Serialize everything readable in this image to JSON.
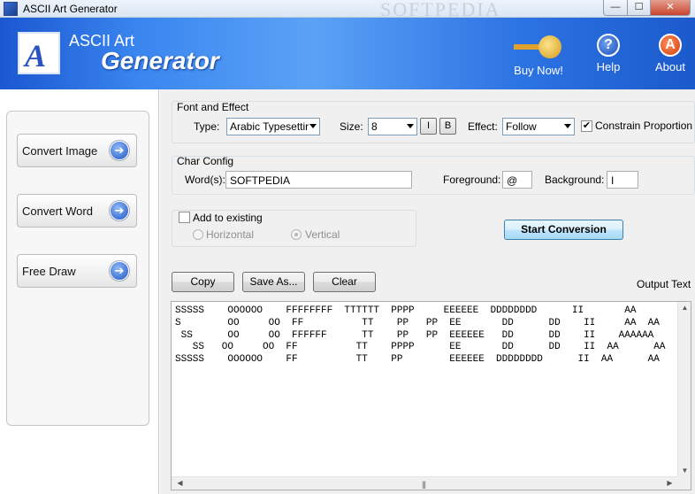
{
  "window": {
    "title": "ASCII Art Generator",
    "watermark": "SOFTPEDIA",
    "minimize": "—",
    "maximize": "☐",
    "close": "✕"
  },
  "header": {
    "title_line1": "ASCII Art",
    "title_line2": "Generator",
    "logo_letter": "A",
    "buttons": [
      {
        "label": "Buy Now!",
        "icon": "key-icon"
      },
      {
        "label": "Help",
        "icon": "help-icon",
        "glyph": "?"
      },
      {
        "label": "About",
        "icon": "about-icon",
        "glyph": "A"
      }
    ],
    "colors": {
      "banner": "#2c73e3"
    }
  },
  "sidebar": {
    "items": [
      {
        "label": "Convert Image"
      },
      {
        "label": "Convert Word"
      },
      {
        "label": "Free Draw"
      }
    ]
  },
  "font_effect": {
    "title": "Font and Effect",
    "type_label": "Type:",
    "type_value": "Arabic Typesettir",
    "size_label": "Size:",
    "size_value": "8",
    "italic": "I",
    "bold": "B",
    "effect_label": "Effect:",
    "effect_value": "Follow",
    "constrain_label": "Constrain Proportion",
    "constrain_checked": true
  },
  "char_config": {
    "title": "Char Config",
    "words_label": "Word(s):",
    "words_value": "SOFTPEDIA",
    "fg_label": "Foreground:",
    "fg_value": "@",
    "bg_label": "Background:",
    "bg_value": "I"
  },
  "add_existing": {
    "label": "Add to existing",
    "checked": false,
    "horizontal": "Horizontal",
    "vertical": "Vertical"
  },
  "actions": {
    "start": "Start Conversion",
    "copy": "Copy",
    "save_as": "Save As...",
    "clear": "Clear",
    "output_label": "Output Text"
  },
  "output": {
    "text": "SSSSS    OOOOOO    FFFFFFFF  TTTTTT  PPPP     EEEEEE  DDDDDDDD      II       AA\nS        OO     OO  FF          TT    PP   PP  EE       DD      DD    II     AA  AA\n SS      OO     OO  FFFFFF      TT    PP   PP  EEEEEE   DD      DD    II    AAAAAA\n   SS   OO     OO  FF          TT    PPPP      EE       DD      DD    II  AA      AA\nSSSSS    OOOOOO    FF          TT    PP        EEEEEE  DDDDDDDD      II  AA      AA"
  }
}
